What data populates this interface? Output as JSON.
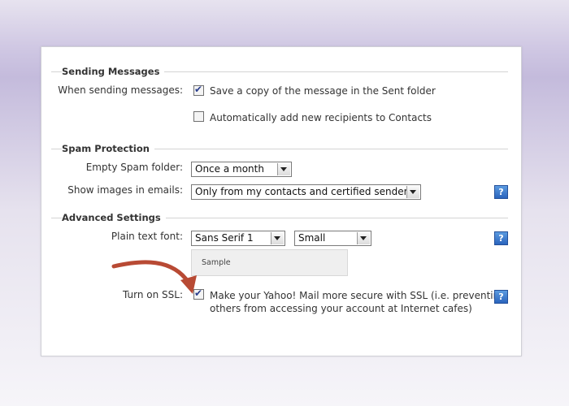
{
  "sending": {
    "title": "Sending Messages",
    "label": "When sending messages:",
    "save_copy": {
      "label": "Save a copy of the message in the Sent folder",
      "checked": true
    },
    "auto_add": {
      "label": "Automatically add new recipients to Contacts",
      "checked": false
    }
  },
  "spam": {
    "title": "Spam Protection",
    "empty_label": "Empty Spam folder:",
    "empty_value": "Once a month",
    "images_label": "Show images in emails:",
    "images_value": "Only from my contacts and certified senders"
  },
  "advanced": {
    "title": "Advanced Settings",
    "font_label": "Plain text font:",
    "font_family": "Sans Serif 1",
    "font_size": "Small",
    "sample_text": "Sample",
    "ssl_label": "Turn on SSL:",
    "ssl_text_line1": "Make your Yahoo! Mail more secure with SSL (i.e. preventing",
    "ssl_text_line2": "others from accessing your account at Internet cafes)",
    "ssl_checked": true
  },
  "icons": {
    "help": "?",
    "check": "✔"
  },
  "colors": {
    "arrow": "#b84a34",
    "help_blue": "#3a78cf"
  }
}
